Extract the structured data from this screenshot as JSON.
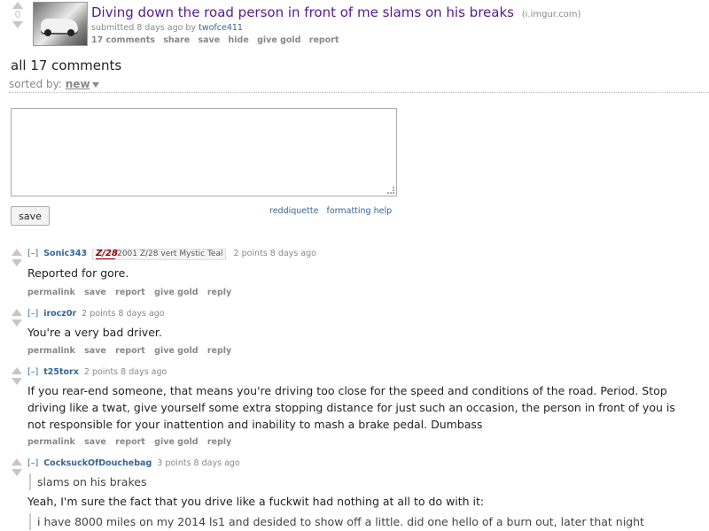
{
  "post": {
    "score": "0",
    "title": "Diving down the road person in front of me slams on his breaks",
    "domain": "(i.imgur.com)",
    "submitted": "submitted 8 days ago by",
    "author": "twofce411",
    "buttons": [
      "17 comments",
      "share",
      "save",
      "hide",
      "give gold",
      "report"
    ]
  },
  "comments_header": {
    "title": "all 17 comments",
    "sort_label": "sorted by:",
    "sort_value": "new"
  },
  "reply_form": {
    "textarea_value": "",
    "save_label": "save",
    "links": [
      "reddiquette",
      "formatting help"
    ]
  },
  "comments": [
    {
      "toggle": "[–]",
      "author": "Sonic343",
      "flair_logo": "Z/28",
      "flair": "2001 Z/28 vert Mystic Teal",
      "meta": "2 points 8 days ago",
      "body": [
        "Reported for gore."
      ],
      "buttons": [
        "permalink",
        "save",
        "report",
        "give gold",
        "reply"
      ]
    },
    {
      "toggle": "[–]",
      "author": "irocz0r",
      "meta": "2 points 8 days ago",
      "body": [
        "You're a very bad driver."
      ],
      "buttons": [
        "permalink",
        "save",
        "report",
        "give gold",
        "reply"
      ]
    },
    {
      "toggle": "[–]",
      "author": "t25torx",
      "meta": "2 points 8 days ago",
      "body": [
        "If you rear-end someone, that means you're driving too close for the speed and conditions of the road. Period. Stop driving like a twat, give yourself some extra stopping distance for just such an occasion, the person in front of you is not responsible for your inattention and inability to mash a brake pedal. Dumbass"
      ],
      "buttons": [
        "permalink",
        "save",
        "report",
        "give gold",
        "reply"
      ]
    },
    {
      "toggle": "[–]",
      "author": "CocksuckOfDouchebag",
      "meta": "3 points 8 days ago",
      "quote1": "slams on his brakes",
      "body": [
        "Yeah, I'm sure the fact that you drive like a fuckwit had nothing at all to do with it:"
      ],
      "quote2": "i have 8000 miles on my 2014 ls1 and desided to show off a little. did one hello of a burn out, later that night"
    }
  ],
  "colors": {
    "link": "#336699",
    "visited_title": "#551a8b",
    "muted": "#888888"
  }
}
